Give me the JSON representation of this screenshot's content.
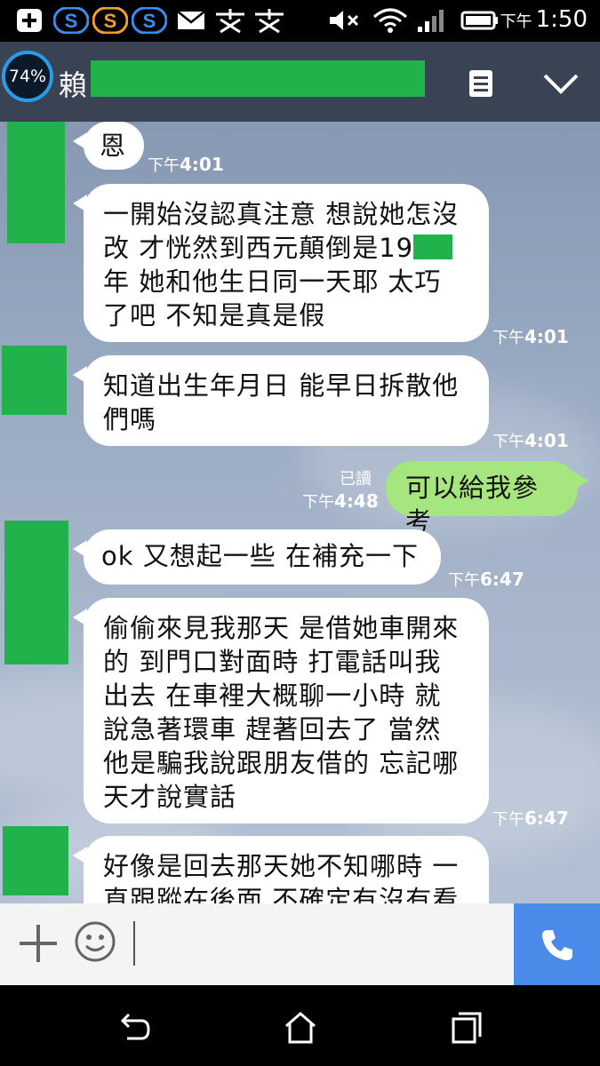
{
  "status_bar": {
    "time_prefix": "下午",
    "time": "1:50",
    "icons": [
      "add-box-icon",
      "s-app-icon",
      "s-app-icon",
      "s-app-icon",
      "mail-icon",
      "chat-app-icon",
      "chat-app-icon",
      "mute-icon",
      "wifi-icon",
      "signal-icon",
      "battery-icon"
    ]
  },
  "header": {
    "battery_percent": "74%",
    "title_visible": "賴",
    "icons": [
      "menu-icon",
      "chevron-down-icon"
    ]
  },
  "messages": [
    {
      "dir": "in",
      "text": "恩",
      "time_prefix": "下午",
      "time": "4:01"
    },
    {
      "dir": "in",
      "lines": [
        "一開始沒認真注意  想說她怎沒",
        "改  才恍然到西元顛倒是19",
        "年  她和他生日同一天耶  太巧",
        "了吧   不知是真是假"
      ],
      "time_prefix": "下午",
      "time": "4:01"
    },
    {
      "dir": "in",
      "lines": [
        "知道出生年月日 能早日拆散他",
        "們嗎"
      ],
      "time_prefix": "下午",
      "time": "4:01"
    },
    {
      "dir": "out",
      "text": "可以給我參考",
      "read": "已讀",
      "time_prefix": "下午",
      "time": "4:48"
    },
    {
      "dir": "in",
      "text": "ok  又想起一些  在補充一下",
      "time_prefix": "下午",
      "time": "6:47"
    },
    {
      "dir": "in",
      "lines": [
        "偷偷來見我那天   是借她車開來",
        "的    到門口對面時  打電話叫我",
        "出去   在車裡大概聊一小時   就",
        "說急著環車  趕著回去了    當然",
        "他是騙我說跟朋友借的   忘記哪",
        "天才說實話"
      ],
      "time_prefix": "下午",
      "time": "6:47"
    },
    {
      "dir": "in",
      "lines": [
        "好像是回去那天她不知哪時  一",
        "直跟蹤在後面   不確定有沒有看"
      ]
    }
  ],
  "input_bar": {
    "icons": [
      "plus-icon",
      "emoji-icon",
      "phone-icon"
    ]
  },
  "nav_bar": {
    "icons": [
      "back-icon",
      "home-icon",
      "recents-icon"
    ]
  },
  "colors": {
    "header_bg": "#3a4353",
    "incoming_bubble": "#ffffff",
    "outgoing_bubble": "#a6e67f",
    "redaction": "#21b24b",
    "call_button": "#4a8ae8"
  }
}
